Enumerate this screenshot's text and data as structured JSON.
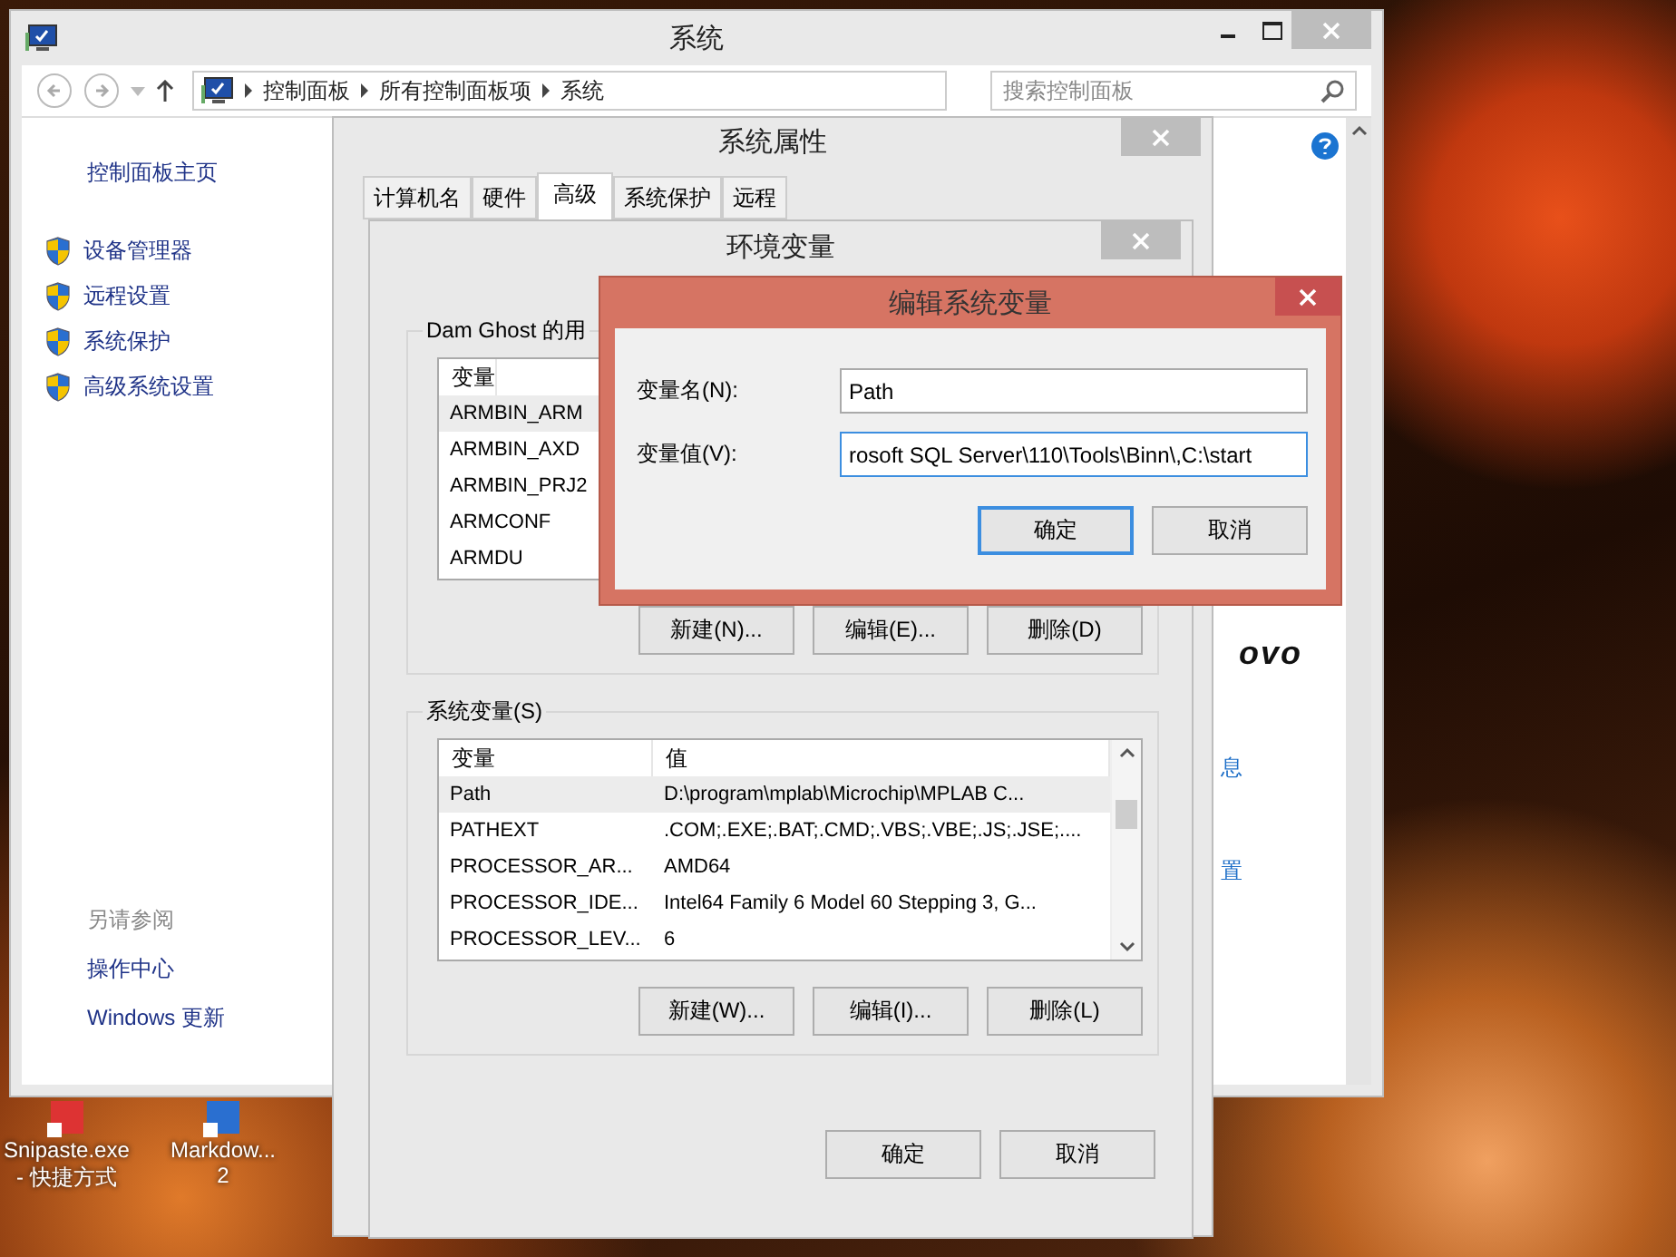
{
  "desktop": {
    "icons": [
      {
        "lines": [
          "Snipaste.exe",
          "- 快捷方式"
        ]
      },
      {
        "lines": [
          "Markdow...",
          "2"
        ]
      }
    ]
  },
  "system_window": {
    "title": "系统",
    "address": [
      "控制面板",
      "所有控制面板项",
      "系统"
    ],
    "search": {
      "placeholder": "搜索控制面板"
    },
    "sidebar": {
      "home": "控制面板主页",
      "items": [
        "设备管理器",
        "远程设置",
        "系统保护",
        "高级系统设置"
      ],
      "see_also_title": "另请参阅",
      "see_also": [
        "操作中心",
        "Windows 更新"
      ]
    },
    "logo_fragment": "ovo",
    "link_fragments": [
      "息",
      "置"
    ]
  },
  "properties_window": {
    "title": "系统属性",
    "tabs": [
      {
        "label": "计算机名",
        "selected": false
      },
      {
        "label": "硬件",
        "selected": false
      },
      {
        "label": "高级",
        "selected": true
      },
      {
        "label": "系统保护",
        "selected": false
      },
      {
        "label": "远程",
        "selected": false
      }
    ]
  },
  "env_window": {
    "title": "环境变量",
    "user_group": {
      "title": "Dam Ghost 的用",
      "columns": [
        "变量"
      ],
      "rows": [
        {
          "name": "ARMBIN_ARM",
          "selected": true
        },
        {
          "name": "ARMBIN_AXD",
          "selected": false
        },
        {
          "name": "ARMBIN_PRJ2",
          "selected": false
        },
        {
          "name": "ARMCONF",
          "selected": false
        },
        {
          "name": "ARMDU",
          "selected": false
        }
      ],
      "buttons": [
        "新建(N)...",
        "编辑(E)...",
        "删除(D)"
      ]
    },
    "system_group": {
      "title": "系统变量(S)",
      "columns": [
        "变量",
        "值"
      ],
      "rows": [
        {
          "name": "Path",
          "value": "D:\\program\\mplab\\Microchip\\MPLAB C...",
          "selected": true
        },
        {
          "name": "PATHEXT",
          "value": ".COM;.EXE;.BAT;.CMD;.VBS;.VBE;.JS;.JSE;....",
          "selected": false
        },
        {
          "name": "PROCESSOR_AR...",
          "value": "AMD64",
          "selected": false
        },
        {
          "name": "PROCESSOR_IDE...",
          "value": "Intel64 Family 6 Model 60 Stepping 3, G...",
          "selected": false
        },
        {
          "name": "PROCESSOR_LEV...",
          "value": "6",
          "selected": false
        }
      ],
      "buttons": [
        "新建(W)...",
        "编辑(I)...",
        "删除(L)"
      ]
    },
    "buttons": [
      "确定",
      "取消"
    ]
  },
  "edit_dialog": {
    "title": "编辑系统变量",
    "fields": [
      {
        "label": "变量名(N):",
        "value": "Path",
        "focused": false
      },
      {
        "label": "变量值(V):",
        "value": "rosoft SQL Server\\110\\Tools\\Binn\\,C:\\start",
        "focused": true
      }
    ],
    "buttons": [
      {
        "label": "确定",
        "default": true
      },
      {
        "label": "取消",
        "default": false
      }
    ]
  }
}
